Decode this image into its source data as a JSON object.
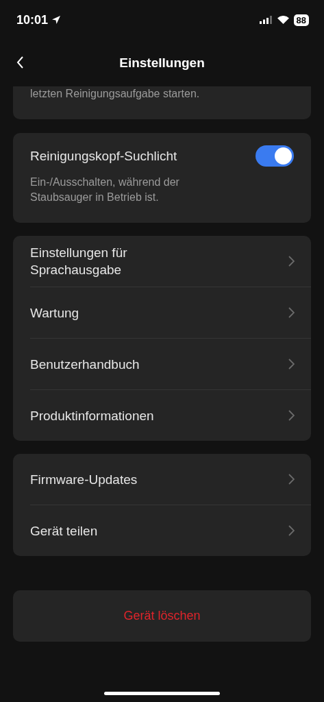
{
  "status_bar": {
    "time": "10:01",
    "battery": "88"
  },
  "header": {
    "title": "Einstellungen"
  },
  "partial_card": {
    "description": "letzten Reinigungsaufgabe starten."
  },
  "toggle_card": {
    "label": "Reinigungskopf-Suchlicht",
    "on": true,
    "description": "Ein-/Ausschalten, während der Staubsauger in Betrieb ist."
  },
  "menu_groups": [
    {
      "items": [
        "Einstellungen für Sprachausgabe",
        "Wartung",
        "Benutzerhandbuch",
        "Produktinformationen"
      ]
    },
    {
      "items": [
        "Firmware-Updates",
        "Gerät teilen"
      ]
    }
  ],
  "delete_button": "Gerät löschen"
}
